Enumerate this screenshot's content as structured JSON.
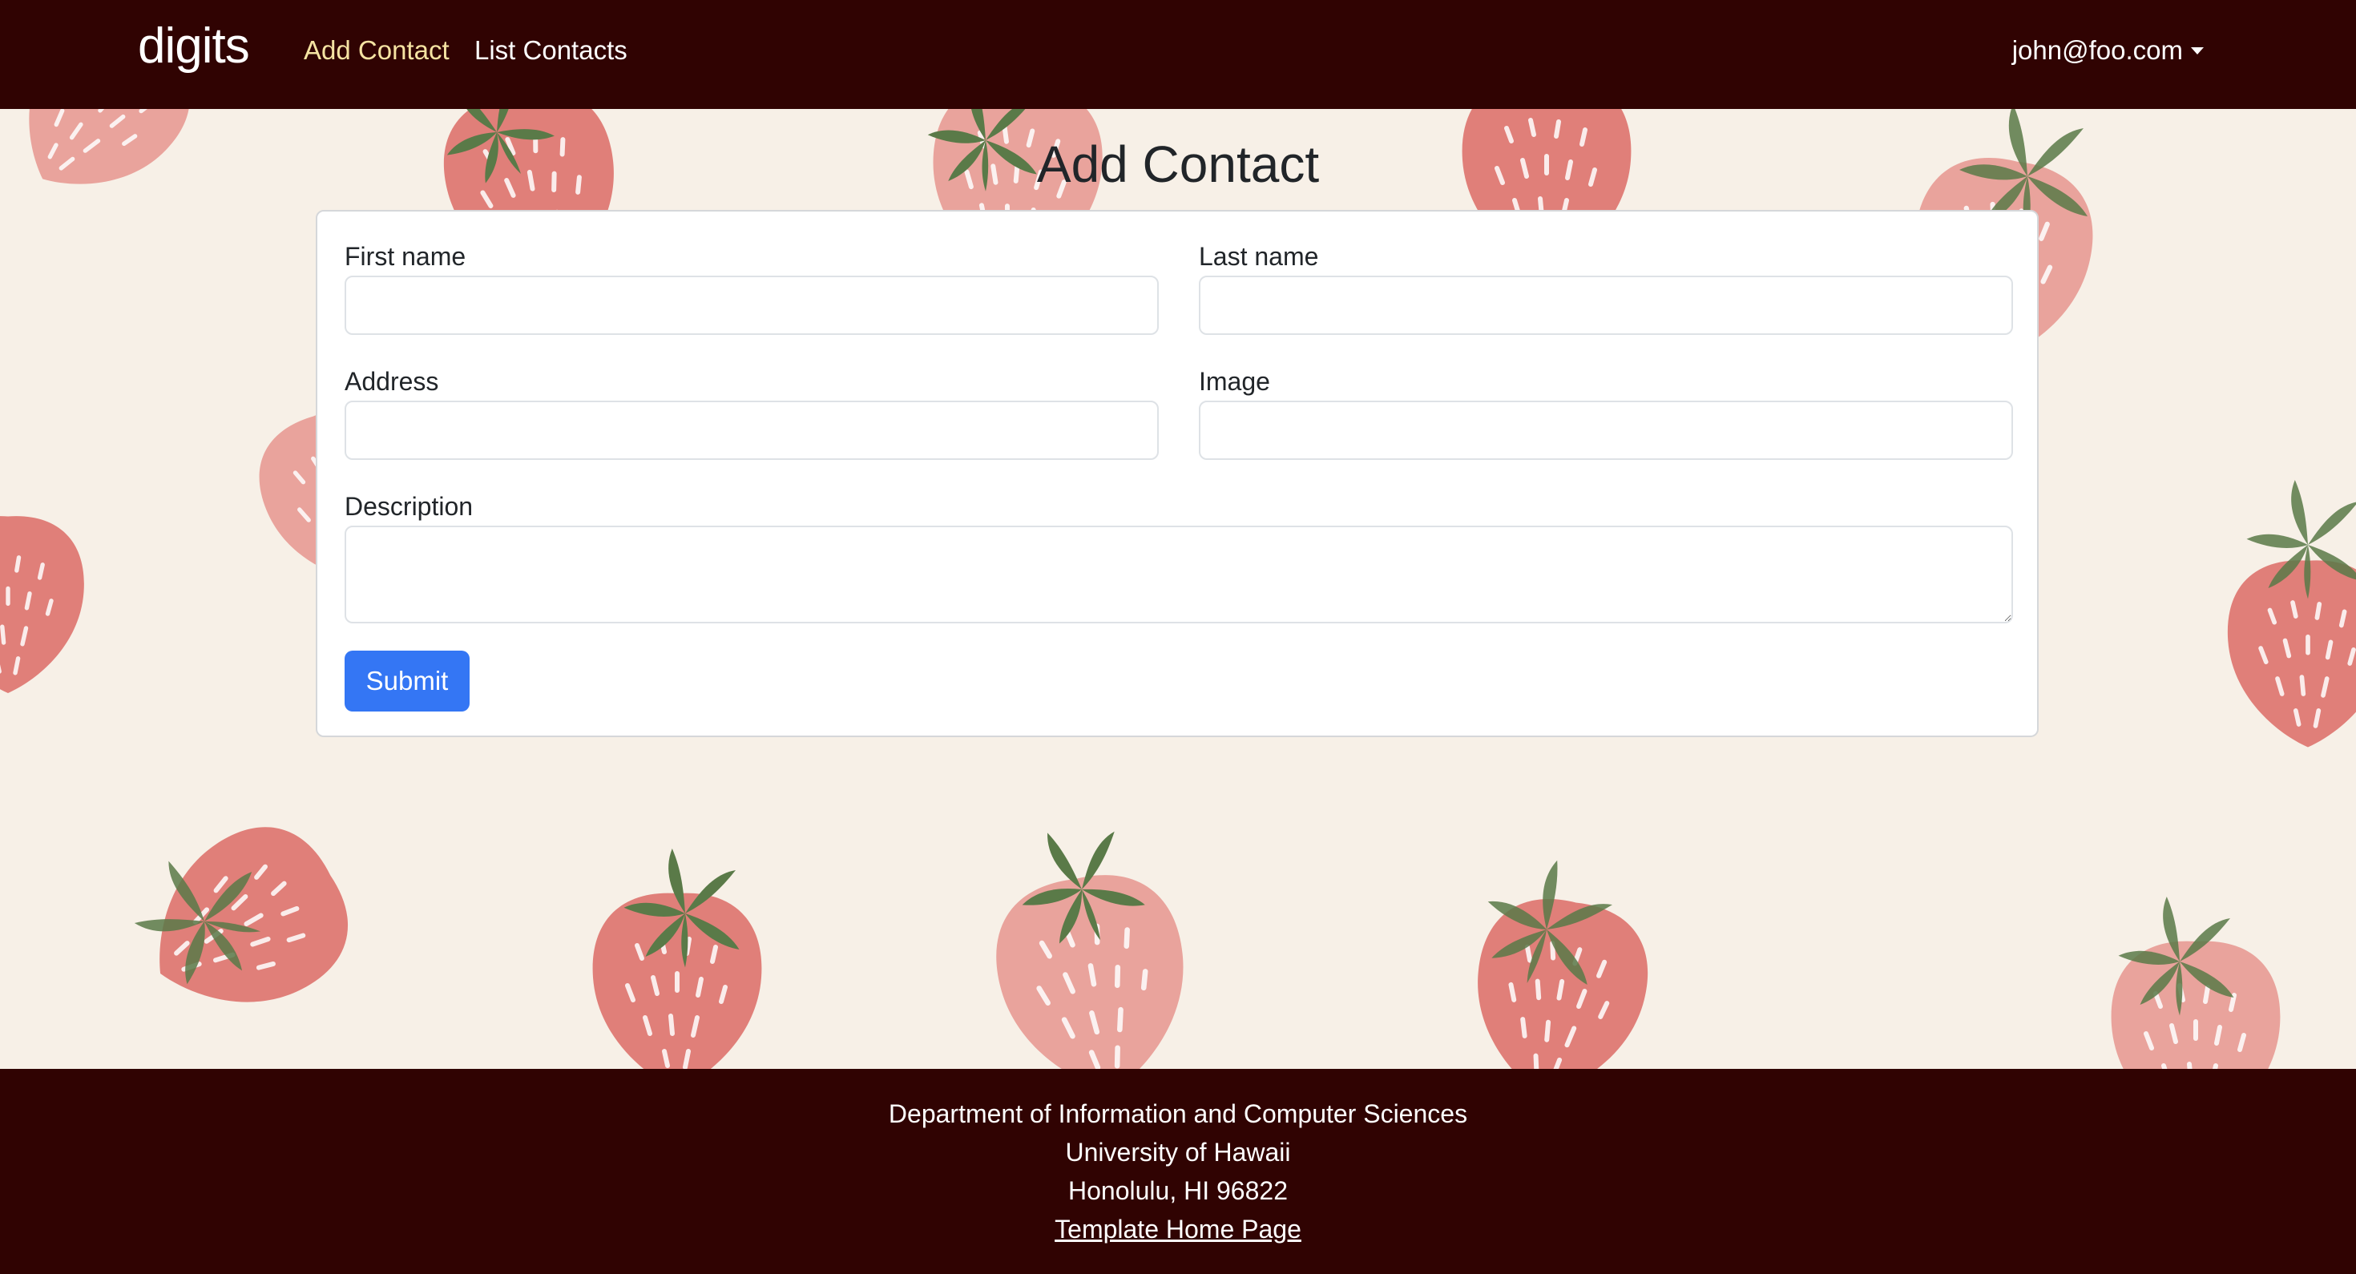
{
  "navbar": {
    "brand": "digits",
    "links": [
      {
        "label": "Add Contact",
        "active": true
      },
      {
        "label": "List Contacts",
        "active": false
      }
    ],
    "user": "john@foo.com"
  },
  "page": {
    "title": "Add Contact"
  },
  "form": {
    "first_name_label": "First name",
    "first_name_value": "",
    "last_name_label": "Last name",
    "last_name_value": "",
    "address_label": "Address",
    "address_value": "",
    "image_label": "Image",
    "image_value": "",
    "description_label": "Description",
    "description_value": "",
    "submit_label": "Submit"
  },
  "footer": {
    "line1": "Department of Information and Computer Sciences",
    "line2": "University of Hawaii",
    "line3": "Honolulu, HI 96822",
    "link": "Template Home Page"
  },
  "colors": {
    "navbar_bg": "#300302",
    "page_bg": "#f7f0e7",
    "active_link": "#f5e3a2",
    "submit_button": "#3476f4",
    "strawberry": "#e07f79",
    "strawberry_light": "#e9a39c",
    "leaf": "#5a7a48"
  }
}
